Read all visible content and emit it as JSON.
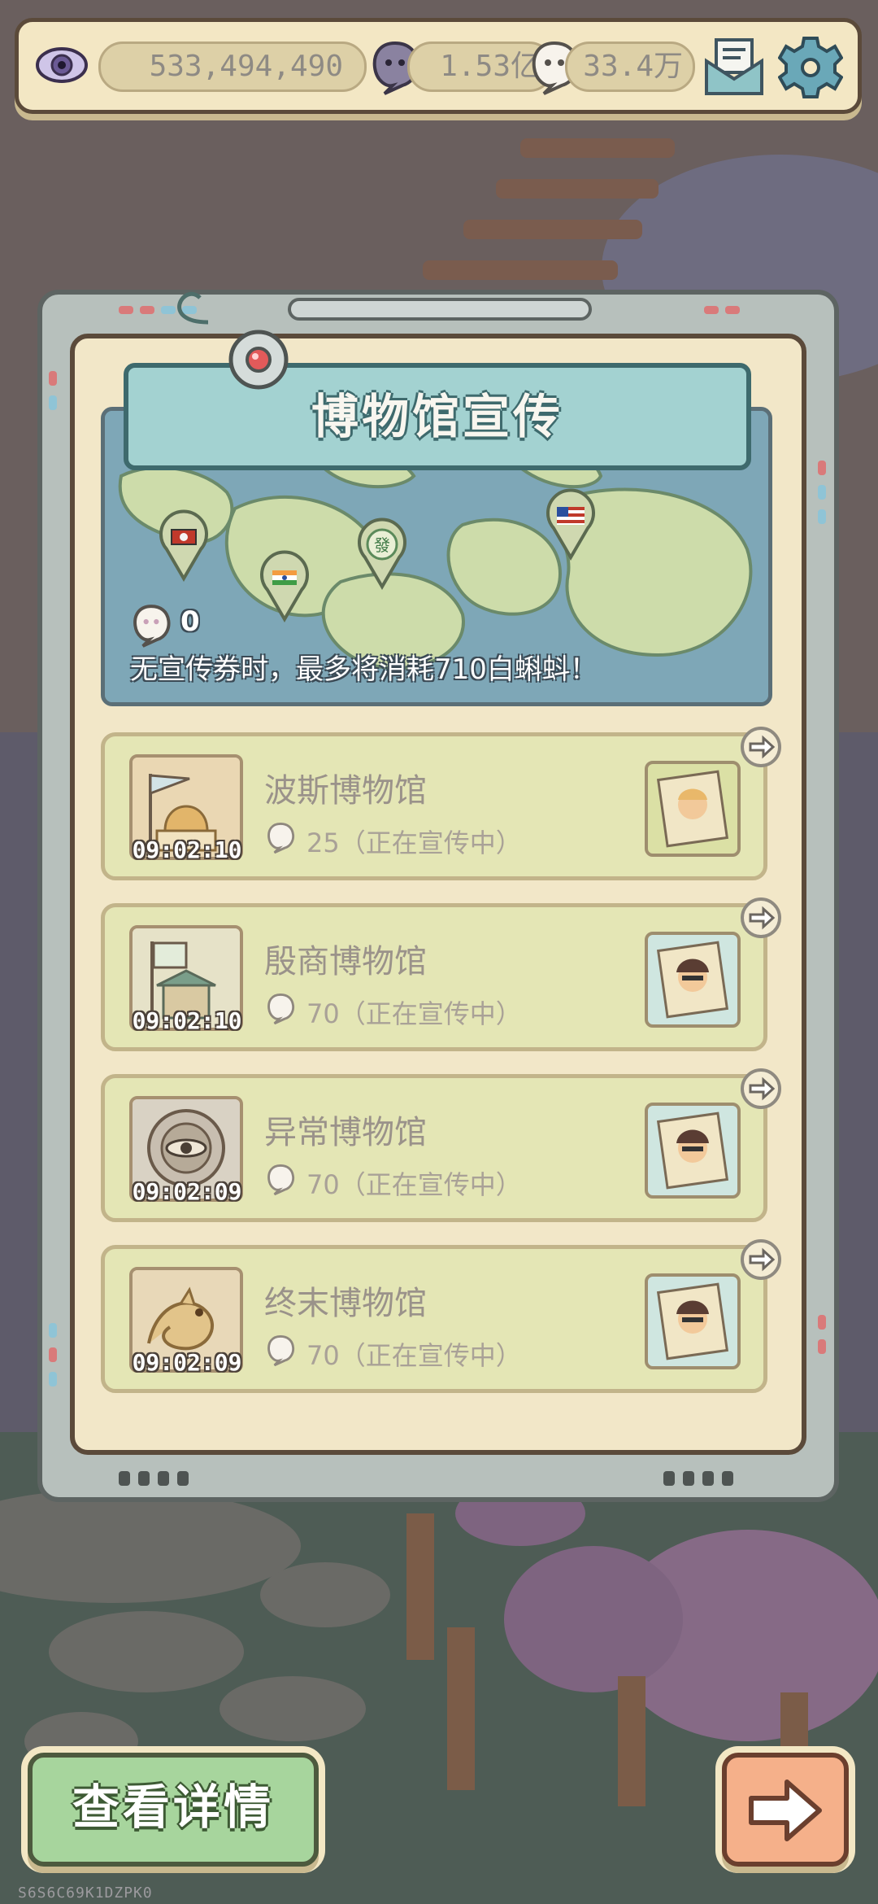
{
  "resources": {
    "views": "533,494,490",
    "purple_currency": "1.53亿",
    "white_tadpole": "33.4万"
  },
  "panel": {
    "title": "博物馆宣传",
    "coupon_count": "0",
    "notice": "无宣传券时，最多将消耗710白蝌蚪！"
  },
  "museums": [
    {
      "name": "波斯博物馆",
      "cost": "25（正在宣传中）",
      "timer": "09:02:10",
      "icon": "persian-dome-icon"
    },
    {
      "name": "殷商博物馆",
      "cost": "70（正在宣传中）",
      "timer": "09:02:10",
      "icon": "shang-pavilion-icon"
    },
    {
      "name": "异常博物馆",
      "cost": "70（正在宣传中）",
      "timer": "09:02:09",
      "icon": "anomaly-eye-icon"
    },
    {
      "name": "终末博物馆",
      "cost": "70（正在宣传中）",
      "timer": "09:02:09",
      "icon": "dragon-icon"
    }
  ],
  "buttons": {
    "details": "查看详情"
  },
  "device_id": "S6S6C69K1DZPK0",
  "colors": {
    "panel_cream": "#f2e7c8",
    "row_fill": "#e4e6b5",
    "title_banner": "#a3d2d1",
    "details_green": "#a7d59d",
    "next_orange": "#f5b08a"
  }
}
